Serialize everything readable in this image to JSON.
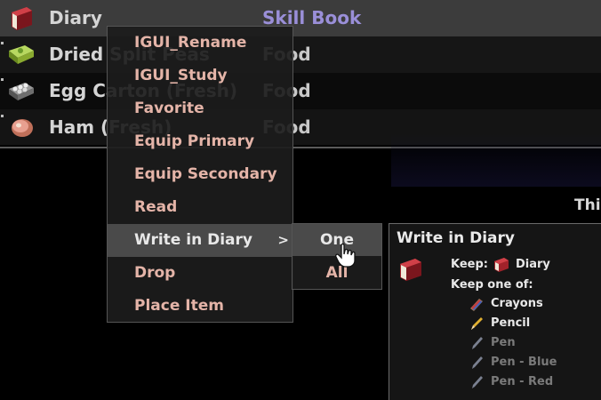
{
  "inventory": {
    "rows": [
      {
        "name": "Diary",
        "category": "Skill Book",
        "icon": "red-book-icon"
      },
      {
        "name": "Dried Split Peas",
        "category": "Food",
        "icon": "peas-box-icon"
      },
      {
        "name": "Egg Carton (Fresh)",
        "category": "Food",
        "icon": "egg-carton-icon"
      },
      {
        "name": "Ham (Fresh)",
        "category": "Food",
        "icon": "ham-icon"
      }
    ],
    "cut_off_text": "This"
  },
  "context_menu": {
    "items": [
      {
        "label": "IGUI_Rename"
      },
      {
        "label": "IGUI_Study"
      },
      {
        "label": "Favorite"
      },
      {
        "label": "Equip Primary"
      },
      {
        "label": "Equip Secondary"
      },
      {
        "label": "Read"
      },
      {
        "label": "Write in Diary",
        "has_submenu": true,
        "arrow": ">"
      },
      {
        "label": "Drop"
      },
      {
        "label": "Place Item"
      }
    ]
  },
  "submenu": {
    "items": [
      {
        "label": "One"
      },
      {
        "label": "All"
      }
    ]
  },
  "tooltip": {
    "title": "Write in Diary",
    "keep_label": "Keep:",
    "keep_item": "Diary",
    "keep_one_label": "Keep one of:",
    "tools": [
      {
        "name": "Crayons",
        "available": true,
        "icon": "crayons-icon"
      },
      {
        "name": "Pencil",
        "available": true,
        "icon": "pencil-icon"
      },
      {
        "name": "Pen",
        "available": false,
        "icon": "pen-icon"
      },
      {
        "name": "Pen - Blue",
        "available": false,
        "icon": "pen-blue-icon"
      },
      {
        "name": "Pen - Red",
        "available": false,
        "icon": "pen-red-icon"
      }
    ]
  },
  "colors": {
    "menu_text": "#e4b4a8",
    "skill_book_category": "#9a8fd8",
    "highlight_bg": "#4a4a4a"
  }
}
